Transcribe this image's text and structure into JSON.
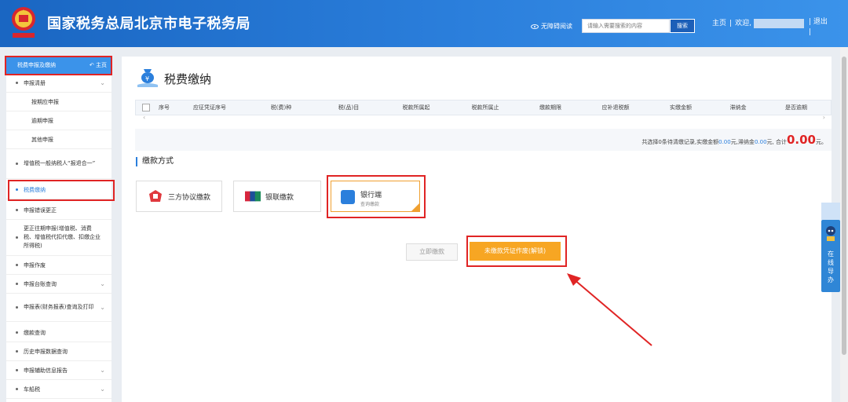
{
  "header": {
    "site_title": "国家税务总局北京市电子税务局",
    "a11y_label": "无障碍阅读",
    "search_placeholder": "请输入需要搜索的内容",
    "search_button": "搜索",
    "home_link": "主页",
    "welcome": "欢迎,",
    "logout": "退出"
  },
  "sidebar": {
    "header": "税费申报及缴纳",
    "home_link": "主页",
    "items": [
      {
        "label": "申报清册"
      },
      {
        "label": "按期应申报"
      },
      {
        "label": "逾期申报"
      },
      {
        "label": "其他申报"
      },
      {
        "label": "增值税一般纳税人“报退合一”"
      },
      {
        "label": "税费缴纳"
      },
      {
        "label": "申报错误更正"
      },
      {
        "label": "更正往期申报(增值税、消费税、增值税代扣代缴、扣缴企业所得税)"
      },
      {
        "label": "申报作废"
      },
      {
        "label": "申报台账查询"
      },
      {
        "label": "申报表(财务报表)查询及打印"
      },
      {
        "label": "缴款查询"
      },
      {
        "label": "历史申报数据查询"
      },
      {
        "label": "申报辅助信息报告"
      },
      {
        "label": "车船税"
      }
    ]
  },
  "main": {
    "title": "税费缴纳",
    "table_headers": [
      "序号",
      "应征凭证序号",
      "税(费)种",
      "税(品)目",
      "税款所属起",
      "税款所属止",
      "缴款期限",
      "应补退税额",
      "实缴金额",
      "滞纳金",
      "是否逾期"
    ],
    "summary": {
      "prefix": "共选择0条待清缴记录,实缴金额",
      "paid_amount": "0.00",
      "mid1": "元,滞纳金",
      "late_fee": "0.00",
      "mid2": "元, 合计",
      "total": "0.00",
      "suffix": "元。"
    },
    "section_title": "缴款方式",
    "payment_methods": [
      {
        "label": "三方协议缴款"
      },
      {
        "label": "银联缴款"
      },
      {
        "label": "银行端",
        "sub": "查询缴款"
      }
    ],
    "btn_pay_now": "立即缴款",
    "btn_void": "未缴款凭证作废(解锁)"
  },
  "float_service": {
    "label": "在线导办"
  },
  "colors": {
    "brand": "#2b7fdc",
    "highlight": "#e02424",
    "warn": "#f7a623"
  }
}
